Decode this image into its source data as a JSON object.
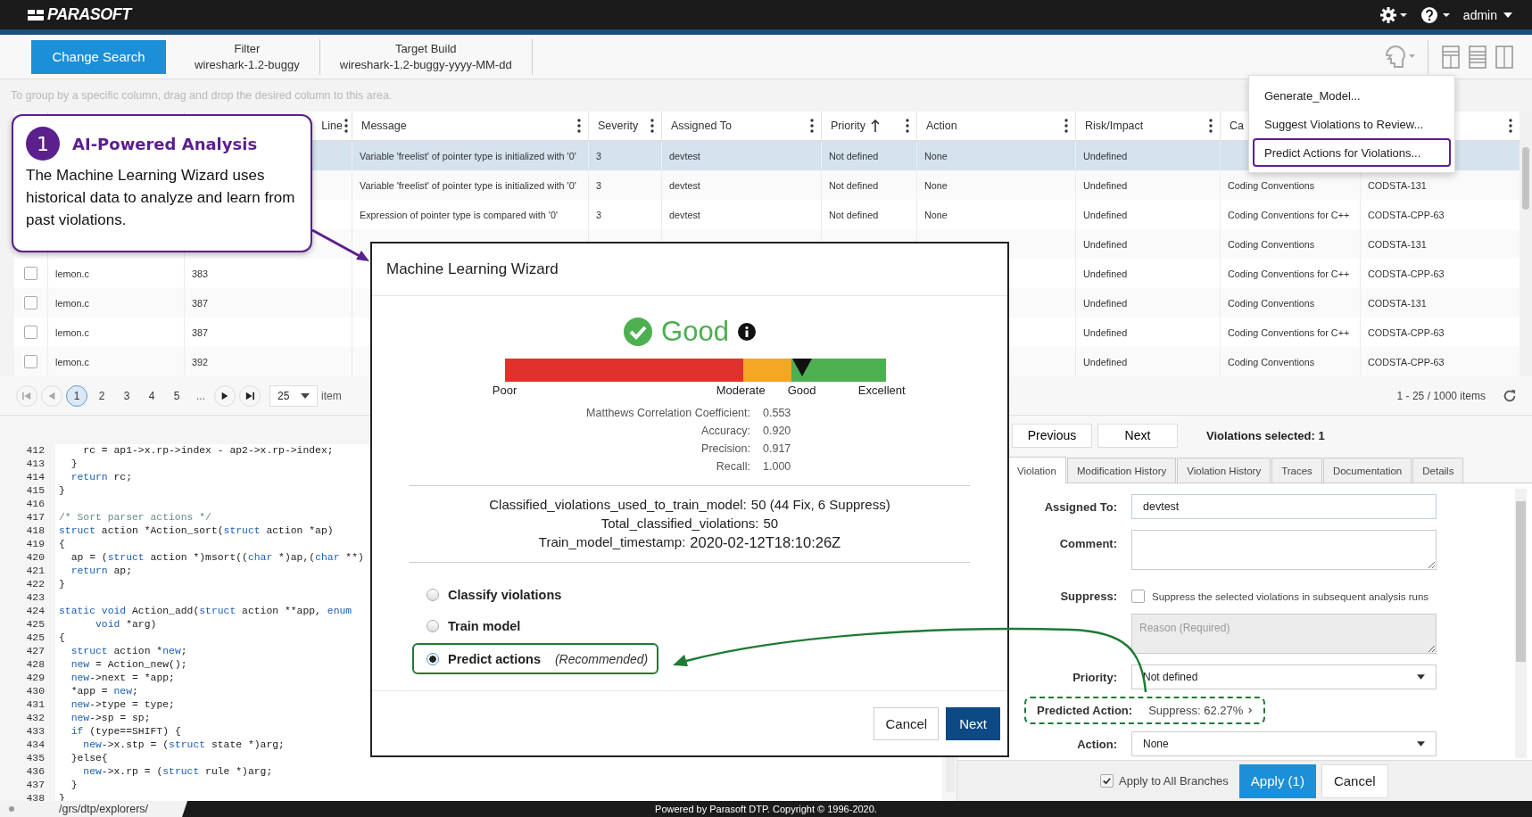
{
  "topbar": {
    "logo": "PARASOFT",
    "user": "admin"
  },
  "header": {
    "change_search": "Change Search",
    "filters": [
      {
        "label": "Filter",
        "value": "wireshark-1.2-buggy"
      },
      {
        "label": "Target Build",
        "value": "wireshark-1.2-buggy-yyyy-MM-dd"
      }
    ]
  },
  "group_hint": "To group by a specific column, drag and drop the desired column to this area.",
  "table": {
    "columns": [
      {
        "kind": "covered"
      },
      {
        "kind": "label",
        "label": "Line"
      },
      {
        "kind": "label",
        "label": "Message"
      },
      {
        "kind": "label",
        "label": "Severity"
      },
      {
        "kind": "label",
        "label": "Assigned To"
      },
      {
        "kind": "label",
        "label": "Priority",
        "sorted": true
      },
      {
        "kind": "label",
        "label": "Action"
      },
      {
        "kind": "label",
        "label": "Risk/Impact"
      },
      {
        "kind": "label",
        "label": "Ca"
      },
      {
        "kind": "covered"
      }
    ],
    "rows": [
      {
        "selected": true,
        "cells": [
          null,
          null,
          "Variable 'freelist' of pointer type is initialized with '0'",
          "3",
          "devtest",
          "Not defined",
          "None",
          "Undefined",
          null,
          null
        ]
      },
      {
        "selected": false,
        "cells": [
          null,
          null,
          "Variable 'freelist' of pointer type is initialized with '0'",
          "3",
          "devtest",
          "Not defined",
          "None",
          "Undefined",
          "Coding Conventions",
          "CODSTA-131"
        ]
      },
      {
        "selected": false,
        "cells": [
          null,
          null,
          "Expression of pointer type is compared with '0'",
          "3",
          "devtest",
          "Not defined",
          "None",
          "Undefined",
          "Coding Conventions for C++",
          "CODSTA-CPP-63"
        ]
      },
      {
        "selected": false,
        "cells": [
          null,
          null,
          null,
          null,
          null,
          null,
          null,
          "Undefined",
          "Coding Conventions",
          "CODSTA-131"
        ]
      },
      {
        "selected": false,
        "checked": false,
        "cells": [
          "lemon.c",
          "383",
          null,
          null,
          null,
          null,
          null,
          "Undefined",
          "Coding Conventions for C++",
          "CODSTA-CPP-63"
        ]
      },
      {
        "selected": false,
        "checked": false,
        "cells": [
          "lemon.c",
          "387",
          null,
          null,
          null,
          null,
          null,
          "Undefined",
          "Coding Conventions",
          "CODSTA-131"
        ]
      },
      {
        "selected": false,
        "checked": false,
        "cells": [
          "lemon.c",
          "387",
          null,
          null,
          null,
          null,
          null,
          "Undefined",
          "Coding Conventions for C++",
          "CODSTA-CPP-63"
        ]
      },
      {
        "selected": false,
        "checked": false,
        "cells": [
          "lemon.c",
          "392",
          null,
          null,
          null,
          null,
          null,
          "Undefined",
          "Coding Conventions",
          "CODSTA-CPP-63"
        ]
      }
    ]
  },
  "pagination": {
    "pages": [
      {
        "label": "1",
        "selected": true
      },
      {
        "label": "2",
        "selected": false
      },
      {
        "label": "3",
        "selected": false
      },
      {
        "label": "4",
        "selected": false
      },
      {
        "label": "5",
        "selected": false
      }
    ],
    "ellipsis": "...",
    "page_size": "25",
    "items_label": "item",
    "range": "1 - 25 / 1000 items"
  },
  "code": [
    {
      "num": "412",
      "tokens": [
        {
          "t": "    rc = ap1->x.rp->index - ap2->x.rp->index;",
          "kind": "plain"
        }
      ]
    },
    {
      "num": "413",
      "tokens": [
        {
          "t": "  }",
          "kind": "plain"
        }
      ]
    },
    {
      "num": "414",
      "tokens": [
        {
          "t": "  return",
          "kind": "keyword"
        },
        {
          "t": " rc;",
          "kind": "plain"
        }
      ]
    },
    {
      "num": "415",
      "tokens": [
        {
          "t": "}",
          "kind": "plain"
        }
      ]
    },
    {
      "num": "416"
    },
    {
      "num": "417",
      "tokens": [
        {
          "t": "/* Sort parser actions */",
          "kind": "comment"
        }
      ]
    },
    {
      "num": "418",
      "tokens": [
        {
          "t": "struct",
          "kind": "keyword"
        },
        {
          "t": " action *Action_sort(",
          "kind": "plain"
        },
        {
          "t": "struct",
          "kind": "keyword"
        },
        {
          "t": " action *ap)",
          "kind": "plain"
        }
      ]
    },
    {
      "num": "419",
      "tokens": [
        {
          "t": "{",
          "kind": "plain"
        }
      ]
    },
    {
      "num": "420",
      "tokens": [
        {
          "t": "  ap = (",
          "kind": "plain"
        },
        {
          "t": "struct",
          "kind": "keyword"
        },
        {
          "t": " action *)msort((",
          "kind": "plain"
        },
        {
          "t": "char",
          "kind": "keyword"
        },
        {
          "t": " *)ap,(",
          "kind": "plain"
        },
        {
          "t": "char",
          "kind": "keyword"
        },
        {
          "t": " **)",
          "kind": "plain"
        }
      ]
    },
    {
      "num": "421",
      "tokens": [
        {
          "t": "  return",
          "kind": "keyword"
        },
        {
          "t": " ap;",
          "kind": "plain"
        }
      ]
    },
    {
      "num": "422",
      "tokens": [
        {
          "t": "}",
          "kind": "plain"
        }
      ]
    },
    {
      "num": "423"
    },
    {
      "num": "424",
      "tokens": [
        {
          "t": "static void",
          "kind": "keyword"
        },
        {
          "t": " Action_add(",
          "kind": "plain"
        },
        {
          "t": "struct",
          "kind": "keyword"
        },
        {
          "t": " action **app, ",
          "kind": "plain"
        },
        {
          "t": "enum",
          "kind": "keyword"
        }
      ]
    },
    {
      "num": "425",
      "tokens": [
        {
          "t": "      void",
          "kind": "keyword"
        },
        {
          "t": " *arg)",
          "kind": "plain"
        }
      ]
    },
    {
      "num": "425",
      "tokens": [
        {
          "t": "{",
          "kind": "plain"
        }
      ]
    },
    {
      "num": "427",
      "tokens": [
        {
          "t": "  struct",
          "kind": "keyword"
        },
        {
          "t": " action *",
          "kind": "plain"
        },
        {
          "t": "new",
          "kind": "keyword"
        },
        {
          "t": ";",
          "kind": "plain"
        }
      ]
    },
    {
      "num": "428",
      "tokens": [
        {
          "t": "  new",
          "kind": "keyword"
        },
        {
          "t": " = Action_new();",
          "kind": "plain"
        }
      ]
    },
    {
      "num": "429",
      "tokens": [
        {
          "t": "  new",
          "kind": "keyword"
        },
        {
          "t": "->next = *app;",
          "kind": "plain"
        }
      ]
    },
    {
      "num": "430",
      "tokens": [
        {
          "t": "  *app = ",
          "kind": "plain"
        },
        {
          "t": "new",
          "kind": "keyword"
        },
        {
          "t": ";",
          "kind": "plain"
        }
      ]
    },
    {
      "num": "431",
      "tokens": [
        {
          "t": "  new",
          "kind": "keyword"
        },
        {
          "t": "->type = type;",
          "kind": "plain"
        }
      ]
    },
    {
      "num": "432",
      "tokens": [
        {
          "t": "  new",
          "kind": "keyword"
        },
        {
          "t": "->sp = sp;",
          "kind": "plain"
        }
      ]
    },
    {
      "num": "433",
      "tokens": [
        {
          "t": "  if",
          "kind": "keyword"
        },
        {
          "t": " (type==SHIFT) {",
          "kind": "plain"
        }
      ]
    },
    {
      "num": "434",
      "tokens": [
        {
          "t": "    new",
          "kind": "keyword"
        },
        {
          "t": "->x.stp = (",
          "kind": "plain"
        },
        {
          "t": "struct",
          "kind": "keyword"
        },
        {
          "t": " state *)arg;",
          "kind": "plain"
        }
      ]
    },
    {
      "num": "435",
      "tokens": [
        {
          "t": "  }else{",
          "kind": "plain"
        }
      ]
    },
    {
      "num": "436",
      "tokens": [
        {
          "t": "    new",
          "kind": "keyword"
        },
        {
          "t": "->x.rp = (",
          "kind": "plain"
        },
        {
          "t": "struct",
          "kind": "keyword"
        },
        {
          "t": " rule *)arg;",
          "kind": "plain"
        }
      ]
    },
    {
      "num": "437",
      "tokens": [
        {
          "t": "  }",
          "kind": "plain"
        }
      ]
    },
    {
      "num": "438",
      "tokens": [
        {
          "t": "}",
          "kind": "plain"
        }
      ]
    }
  ],
  "detail": {
    "nav": [
      "Previous",
      "Next"
    ],
    "selected_count": "Violations selected: 1",
    "tabs": [
      {
        "label": "Violation",
        "selected": true
      },
      {
        "label": "Modification History",
        "selected": false
      },
      {
        "label": "Violation History",
        "selected": false
      },
      {
        "label": "Traces",
        "selected": false
      },
      {
        "label": "Documentation",
        "selected": false
      },
      {
        "label": "Details",
        "selected": false
      }
    ],
    "assigned_to": {
      "label": "Assigned To:",
      "value": "devtest"
    },
    "comment": {
      "label": "Comment:"
    },
    "suppress": {
      "label": "Suppress:",
      "checked": false,
      "text": "Suppress the selected violations in subsequent analysis runs",
      "placeholder": "Reason (Required)"
    },
    "priority": {
      "label": "Priority:",
      "value": "Not defined"
    },
    "predicted_action": {
      "label": "Predicted Action:",
      "value": "Suppress: 62.27%",
      "highlighted": true
    },
    "action": {
      "label": "Action:",
      "value": "None"
    },
    "apply_all": {
      "label": "Apply to All Branches",
      "checked": true
    },
    "apply": "Apply (1)",
    "cancel": "Cancel"
  },
  "wizard": {
    "title": "Machine Learning Wizard",
    "rating": "Good",
    "gauge": {
      "level": 0.78,
      "labels": [
        "Poor",
        "Moderate",
        "Good",
        "Excellent"
      ]
    },
    "metrics": [
      {
        "label": "Matthews Correlation Coefficient:",
        "value": "0.553"
      },
      {
        "label": "Accuracy:",
        "value": "0.920"
      },
      {
        "label": "Precision:",
        "value": "0.917"
      },
      {
        "label": "Recall:",
        "value": "1.000"
      }
    ],
    "stats": [
      {
        "label": "Classified_violations_used_to_train_model:",
        "value": "50 (44 Fix, 6 Suppress)"
      },
      {
        "label": "Total_classified_violations:",
        "value": "50"
      },
      {
        "label": "Train_model_timestamp:",
        "value": "2020-02-12T18:10:26Z"
      }
    ],
    "options": [
      {
        "label": "Classify violations",
        "selected": false,
        "highlighted": false
      },
      {
        "label": "Train model",
        "selected": false,
        "highlighted": false
      },
      {
        "label": "Predict actions",
        "note": "(Recommended)",
        "selected": true,
        "highlighted": true
      }
    ],
    "cancel": "Cancel",
    "next": "Next"
  },
  "callout": {
    "number": "1",
    "title": "AI-Powered Analysis",
    "text": "The Machine Learning Wizard uses historical data to analyze and learn from past violations."
  },
  "menu": {
    "items": [
      {
        "label": "Generate_Model...",
        "highlighted": false
      },
      {
        "label": "Suggest Violations to Review...",
        "highlighted": false
      },
      {
        "label": "Predict Actions for Violations...",
        "highlighted": true
      }
    ]
  },
  "status_bar": {
    "path": "/grs/dtp/explorers/",
    "copyright": "Powered by Parasoft DTP. Copyright © 1996-2020."
  }
}
